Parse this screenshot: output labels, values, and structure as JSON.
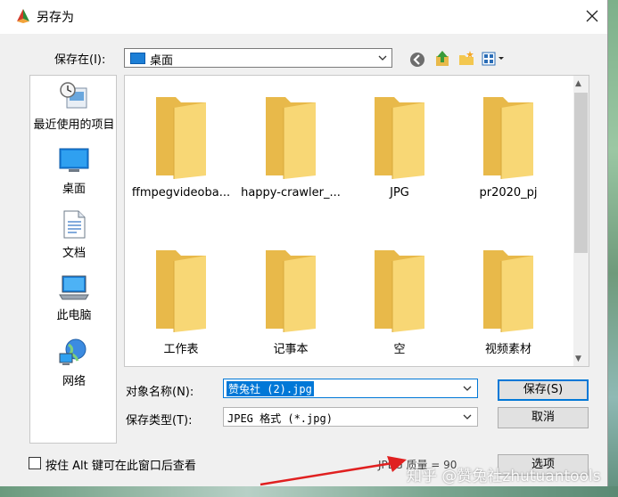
{
  "window": {
    "title": "另存为"
  },
  "save_in": {
    "label": "保存在(I):",
    "value": "桌面"
  },
  "places": [
    {
      "label": "最近使用的项目",
      "icon": "recent-items-icon"
    },
    {
      "label": "桌面",
      "icon": "desktop-icon"
    },
    {
      "label": "文档",
      "icon": "documents-icon"
    },
    {
      "label": "此电脑",
      "icon": "computer-icon"
    },
    {
      "label": "网络",
      "icon": "network-icon"
    }
  ],
  "files": [
    {
      "name": "ffmpegvideoba...",
      "icon": "folder-icon"
    },
    {
      "name": "happy-crawler_...",
      "icon": "folder-icon"
    },
    {
      "name": "JPG",
      "icon": "folder-icon"
    },
    {
      "name": "pr2020_pj",
      "icon": "folder-icon"
    },
    {
      "name": "工作表",
      "icon": "folder-icon"
    },
    {
      "name": "记事本",
      "icon": "folder-icon"
    },
    {
      "name": "空",
      "icon": "folder-icon"
    },
    {
      "name": "视频素材",
      "icon": "folder-icon"
    }
  ],
  "object_name": {
    "label": "对象名称(N):",
    "value": "赞兔社 (2).jpg"
  },
  "save_type": {
    "label": "保存类型(T):",
    "value": "JPEG 格式 (*.jpg)"
  },
  "buttons": {
    "save": "保存(S)",
    "cancel": "取消",
    "options": "选项"
  },
  "alt_checkbox": {
    "label": "按住 Alt 键可在此窗口后查看",
    "checked": false
  },
  "quality": {
    "text": "JPEG 质量 = 90"
  },
  "watermark": {
    "text": "知乎 @赞兔社zhutuantools"
  },
  "colors": {
    "accent": "#0078d7",
    "folder": "#f8d775",
    "folder_dark": "#e8b94a"
  }
}
